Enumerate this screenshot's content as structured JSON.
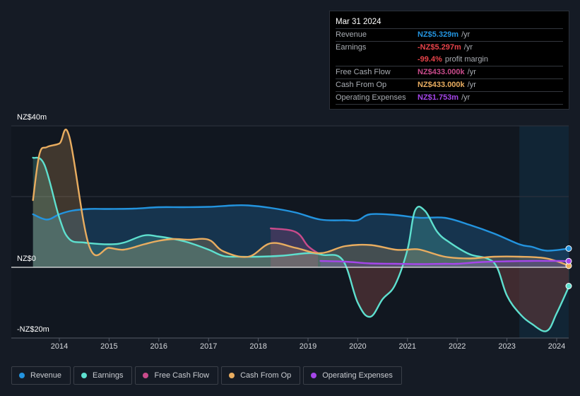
{
  "tooltip": {
    "date": "Mar 31 2024",
    "rows": [
      {
        "label": "Revenue",
        "value": "NZ$5.329m",
        "unit": "/yr",
        "color": "#2394df"
      },
      {
        "label": "Earnings",
        "value": "-NZ$5.297m",
        "unit": "/yr",
        "color": "#e8434a"
      },
      {
        "label": "",
        "value": "-99.4%",
        "unit": "profit margin",
        "color": "#e8434a"
      },
      {
        "label": "Free Cash Flow",
        "value": "NZ$433.000k",
        "unit": "/yr",
        "color": "#c94b8b"
      },
      {
        "label": "Cash From Op",
        "value": "NZ$433.000k",
        "unit": "/yr",
        "color": "#e9ad60"
      },
      {
        "label": "Operating Expenses",
        "value": "NZ$1.753m",
        "unit": "/yr",
        "color": "#a546ea"
      }
    ]
  },
  "legend": [
    {
      "label": "Revenue",
      "color": "#2394df"
    },
    {
      "label": "Earnings",
      "color": "#5ee0cf"
    },
    {
      "label": "Free Cash Flow",
      "color": "#c94b8b"
    },
    {
      "label": "Cash From Op",
      "color": "#e9ad60"
    },
    {
      "label": "Operating Expenses",
      "color": "#a546ea"
    }
  ],
  "chart_data": {
    "type": "area",
    "title": "",
    "xlabel": "",
    "ylabel": "",
    "ylim": [
      -20,
      40
    ],
    "xlim": [
      2013.2,
      2024.3
    ],
    "yticks": [
      {
        "value": 40,
        "label": "NZ$40m"
      },
      {
        "value": 0,
        "label": "NZ$0"
      },
      {
        "value": -20,
        "label": "-NZ$20m"
      }
    ],
    "xticks": [
      "2014",
      "2015",
      "2016",
      "2017",
      "2018",
      "2019",
      "2020",
      "2021",
      "2022",
      "2023",
      "2024"
    ],
    "grid": true,
    "legend_position": "bottom-left",
    "highlight_region": [
      2023.25,
      2024.25
    ],
    "series": [
      {
        "name": "Revenue",
        "color": "#2394df",
        "x": [
          2013.47,
          2013.75,
          2014.0,
          2014.25,
          2014.6,
          2015.0,
          2015.5,
          2016.0,
          2016.5,
          2017.0,
          2017.5,
          2017.8,
          2018.25,
          2018.75,
          2019.25,
          2019.75,
          2020.0,
          2020.25,
          2020.75,
          2021.25,
          2021.75,
          2022.25,
          2022.75,
          2023.25,
          2023.5,
          2023.8,
          2024.25
        ],
        "values": [
          15,
          13.5,
          15,
          16,
          16.5,
          16.5,
          16.6,
          17,
          17,
          17.1,
          17.5,
          17.5,
          16.8,
          15.5,
          13.5,
          13.3,
          13.3,
          15,
          14.8,
          14,
          14,
          12,
          9.5,
          6.5,
          5.8,
          4.7,
          5.3
        ]
      },
      {
        "name": "Earnings",
        "color": "#5ee0cf",
        "x": [
          2013.47,
          2013.7,
          2014.0,
          2014.2,
          2014.5,
          2015.0,
          2015.3,
          2015.7,
          2016.0,
          2016.3,
          2016.6,
          2017.0,
          2017.3,
          2017.6,
          2018.0,
          2018.5,
          2019.0,
          2019.3,
          2019.7,
          2020.0,
          2020.25,
          2020.5,
          2020.75,
          2021.0,
          2021.15,
          2021.35,
          2021.6,
          2021.85,
          2022.25,
          2022.6,
          2022.8,
          2023.0,
          2023.25,
          2023.5,
          2023.8,
          2024.0,
          2024.25
        ],
        "values": [
          31,
          29,
          14,
          8,
          7,
          6.5,
          7,
          9,
          8.7,
          8,
          7,
          5,
          3.2,
          3.0,
          3.0,
          3.3,
          4,
          3.5,
          2,
          -10,
          -14,
          -9,
          -5,
          5,
          16,
          16,
          10,
          7,
          3.7,
          2.5,
          0,
          -8,
          -13,
          -16,
          -18,
          -13,
          -5.3
        ]
      },
      {
        "name": "Free Cash Flow",
        "color": "#c94b8b",
        "x": [
          2018.25,
          2018.75,
          2019.0,
          2019.2
        ],
        "values": [
          11,
          10,
          6,
          4
        ]
      },
      {
        "name": "Cash From Op",
        "color": "#e9ad60",
        "x": [
          2013.47,
          2013.6,
          2013.75,
          2014.0,
          2014.2,
          2014.6,
          2015.0,
          2015.3,
          2015.7,
          2016.0,
          2016.3,
          2016.6,
          2017.0,
          2017.3,
          2017.8,
          2018.25,
          2018.75,
          2019.25,
          2019.75,
          2020.25,
          2020.75,
          2021.0,
          2021.25,
          2021.75,
          2022.25,
          2022.75,
          2023.25,
          2023.8,
          2024.25
        ],
        "values": [
          19,
          32,
          34,
          35,
          37,
          6,
          5.5,
          5,
          6.5,
          7.5,
          8,
          7.8,
          7.8,
          4.5,
          3,
          6.8,
          5.5,
          4,
          6,
          6.3,
          5,
          5,
          5,
          3,
          2.5,
          3,
          3,
          2.5,
          0.43
        ]
      },
      {
        "name": "Operating Expenses",
        "color": "#a546ea",
        "x": [
          2019.25,
          2019.75,
          2020.25,
          2020.75,
          2021.25,
          2021.75,
          2022.0,
          2022.5,
          2023.0,
          2023.5,
          2024.0,
          2024.25
        ],
        "values": [
          1.8,
          1.6,
          1.1,
          1.0,
          0.9,
          1.0,
          1.0,
          1.5,
          1.7,
          1.8,
          1.8,
          1.75
        ]
      }
    ]
  }
}
